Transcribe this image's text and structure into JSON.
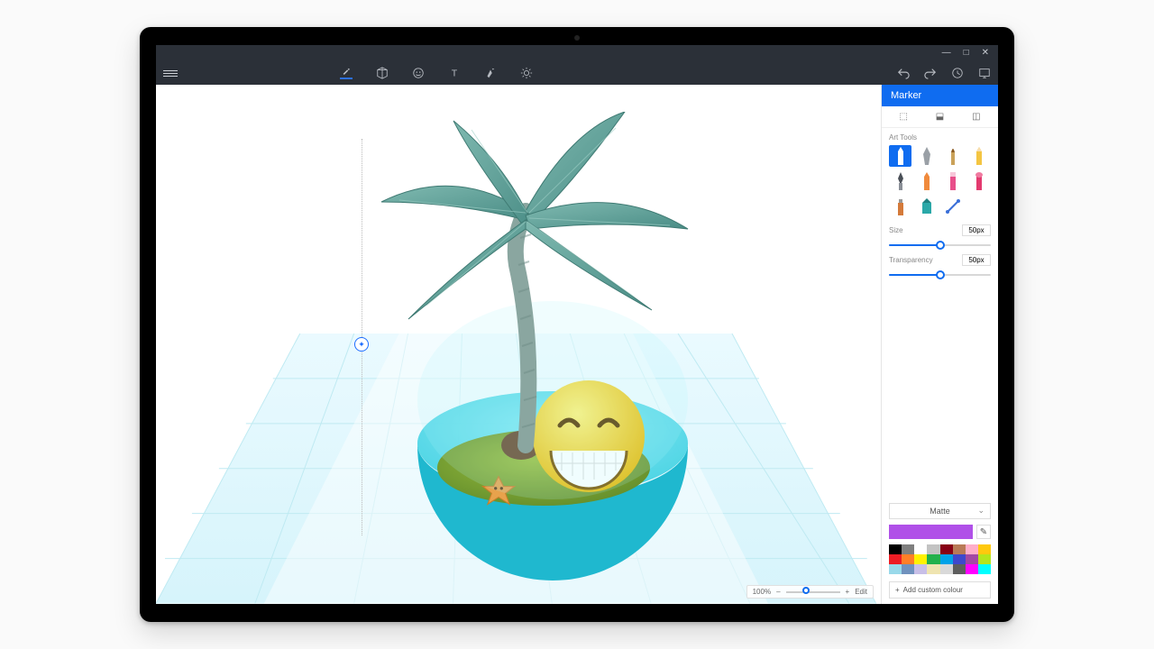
{
  "window": {
    "minimize": "—",
    "maximize": "□",
    "close": "✕"
  },
  "toolbar": {
    "tools": [
      "brushes",
      "3d-shapes",
      "stickers",
      "text",
      "effects",
      "lighting"
    ],
    "right": [
      "undo",
      "redo",
      "history",
      "present"
    ]
  },
  "sidepanel": {
    "header": "Marker",
    "tabs": [
      "⬚",
      "⬓",
      "◫"
    ],
    "art_tools_label": "Art Tools",
    "size_label": "Size",
    "size_value": "50px",
    "transparency_label": "Transparency",
    "transparency_value": "50px",
    "finish": "Matte",
    "add_custom": "Add custom colour",
    "palette": [
      "#000000",
      "#7f7f7f",
      "#ffffff",
      "#c3c3c3",
      "#880015",
      "#b97a57",
      "#ffaec9",
      "#ffc90e",
      "#ed1c24",
      "#ff7f27",
      "#fff200",
      "#22b14c",
      "#00a2e8",
      "#3f48cc",
      "#a349a4",
      "#b5e61d",
      "#99d9ea",
      "#7092be",
      "#c8bfe7",
      "#efe4b0",
      "#d9d9d9",
      "#5e5e5e",
      "#ff00ff",
      "#00ffff"
    ],
    "current_color": "#b050e8"
  },
  "zoom": {
    "percent": "100%",
    "minus": "–",
    "plus": "+",
    "mode": "Edit"
  }
}
